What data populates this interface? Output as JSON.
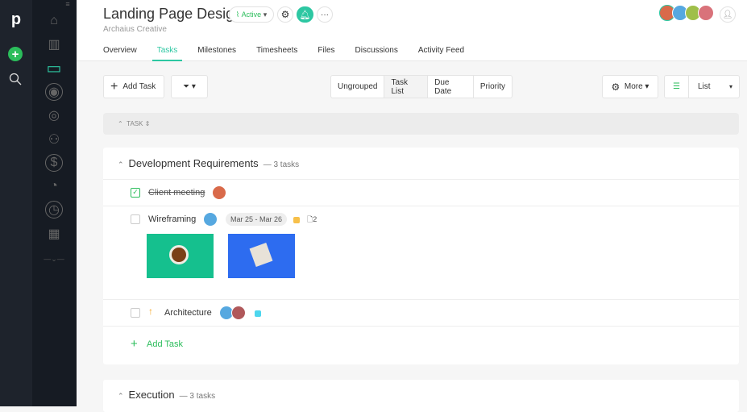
{
  "app": {
    "logo": "p"
  },
  "nav_icons": [
    "home-icon",
    "building-icon",
    "folder-icon",
    "user-circle-icon",
    "eye-icon",
    "users-icon",
    "dollar-icon",
    "pie-chart-icon",
    "clock-icon",
    "calendar-icon"
  ],
  "header": {
    "title": "Landing Page Design",
    "subtitle": "Archaius Creative",
    "status": "Active",
    "tabs": [
      "Overview",
      "Tasks",
      "Milestones",
      "Timesheets",
      "Files",
      "Discussions",
      "Activity Feed"
    ],
    "active_tab": "Tasks"
  },
  "toolbar": {
    "add_task": "Add Task",
    "group_options": [
      "Ungrouped",
      "Task List",
      "Due Date",
      "Priority"
    ],
    "group_selected": "Task List",
    "more": "More",
    "view": "List"
  },
  "table": {
    "column": "TASK"
  },
  "sections": [
    {
      "title": "Development Requirements",
      "count": "— 3 tasks",
      "tasks": [
        {
          "name": "Client meeting",
          "done": true
        },
        {
          "name": "Wireframing",
          "done": false,
          "dates": "Mar 25 - Mar 26",
          "tag_color": "#f7c04a",
          "files": "2"
        },
        {
          "name": "Architecture",
          "done": false,
          "priority": "up",
          "tag_color": "#4dd6ee"
        }
      ],
      "add_task": "Add Task"
    },
    {
      "title": "Execution",
      "count": "— 3 tasks"
    }
  ],
  "colors": {
    "accent": "#2dc7a2",
    "green": "#2bbd5b"
  }
}
